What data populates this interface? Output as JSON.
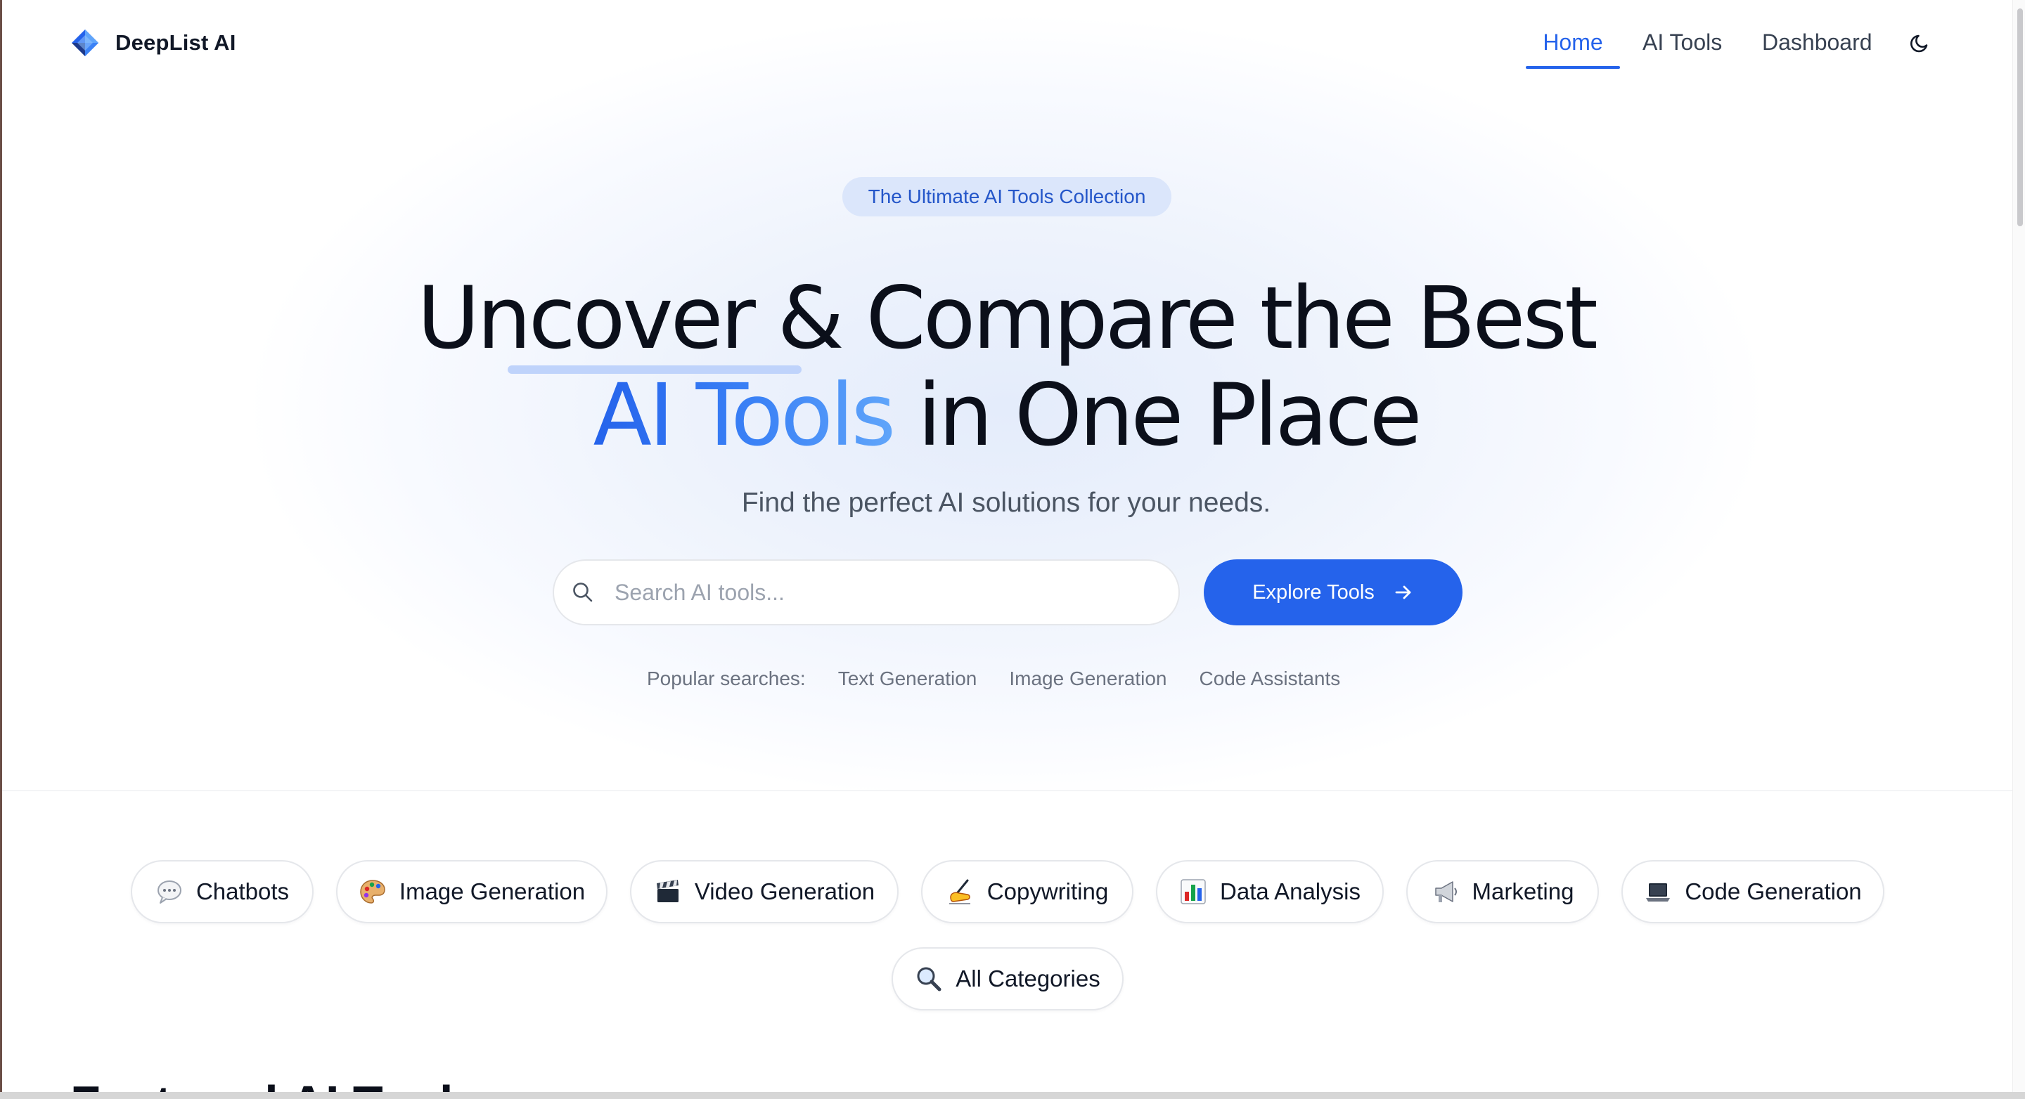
{
  "header": {
    "logo_text": "DeepList AI",
    "nav": [
      {
        "label": "Home",
        "active": true
      },
      {
        "label": "AI Tools",
        "active": false
      },
      {
        "label": "Dashboard",
        "active": false
      }
    ],
    "theme_icon": "moon-icon"
  },
  "hero": {
    "badge": "The Ultimate AI Tools Collection",
    "headline_line1": "Uncover & Compare the Best",
    "headline_highlight": "AI Tools",
    "headline_line2_rest": " in One Place",
    "subtitle": "Find the perfect AI solutions for your needs.",
    "search": {
      "placeholder": "Search AI tools...",
      "value": ""
    },
    "explore_button": "Explore Tools",
    "popular_label": "Popular searches:",
    "popular": [
      "Text Generation",
      "Image Generation",
      "Code Assistants"
    ]
  },
  "categories": [
    {
      "label": "Chatbots",
      "icon": "speech-bubble-icon"
    },
    {
      "label": "Image Generation",
      "icon": "palette-icon"
    },
    {
      "label": "Video Generation",
      "icon": "clapperboard-icon"
    },
    {
      "label": "Copywriting",
      "icon": "writing-hand-icon"
    },
    {
      "label": "Data Analysis",
      "icon": "bar-chart-icon"
    },
    {
      "label": "Marketing",
      "icon": "megaphone-icon"
    },
    {
      "label": "Code Generation",
      "icon": "laptop-icon"
    },
    {
      "label": "All Categories",
      "icon": "magnifier-icon"
    }
  ],
  "featured": {
    "title": "Featured AI Tools"
  },
  "colors": {
    "accent": "#2563eb",
    "badge_bg": "#dbe6fb",
    "text": "#111827",
    "muted": "#6b7280"
  }
}
